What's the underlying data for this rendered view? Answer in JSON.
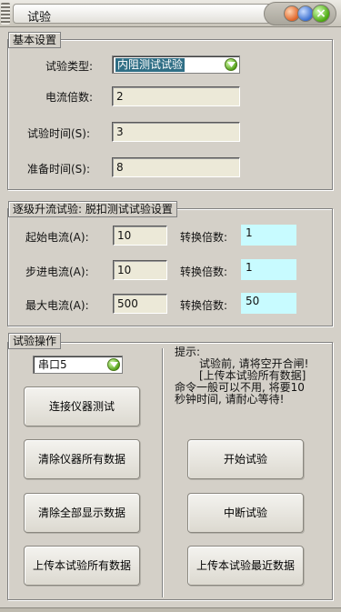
{
  "window": {
    "title": "试验"
  },
  "basic": {
    "legend": "基本设置",
    "type_label": "试验类型:",
    "type_value": "内阻测试试验",
    "multiple_label": "电流倍数:",
    "multiple_value": "2",
    "time_label": "试验时间(S):",
    "time_value": "3",
    "prep_label": "准备时间(S):",
    "prep_value": "8"
  },
  "step": {
    "legend": "逐级升流试验: 脱扣测试试验设置",
    "rows": [
      {
        "label": "起始电流(A):",
        "value": "10",
        "conv_label": "转换倍数:",
        "conv_value": "1"
      },
      {
        "label": "步进电流(A):",
        "value": "10",
        "conv_label": "转换倍数:",
        "conv_value": "1"
      },
      {
        "label": "最大电流(A):",
        "value": "500",
        "conv_label": "转换倍数:",
        "conv_value": "50"
      }
    ]
  },
  "ops": {
    "legend": "试验操作",
    "port_value": "串口5",
    "buttons_left": [
      "连接仪器测试",
      "清除仪器所有数据",
      "清除全部显示数据",
      "上传本试验所有数据"
    ],
    "buttons_right": [
      "开始试验",
      "中断试验",
      "上传本试验最近数据"
    ],
    "tip_title": "提示:",
    "tip_lines": [
      "试验前, 请将空开合闸!",
      "[上传本试验所有数据]",
      "命令一般可以不用, 将要10",
      "秒钟时间, 请耐心等待!"
    ]
  },
  "colors": {
    "cyan_field": "#c8fbff",
    "selected_value": "#2f6e85",
    "window_bg": "#d4d0c8"
  },
  "icons": {
    "minimize": "orange-dot-icon",
    "restore": "blue-dot-icon",
    "close": "green-close-icon",
    "dropdown": "green-dropdown-icon"
  }
}
